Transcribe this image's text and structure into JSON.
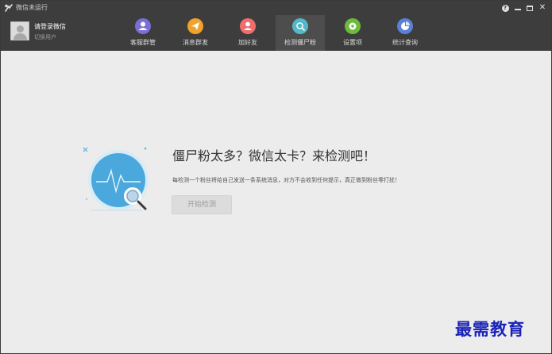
{
  "window": {
    "title": "微信未运行",
    "controls": {
      "help_icon": "help-icon",
      "minimize_icon": "minimize-icon",
      "maximize_icon": "maximize-icon",
      "close_icon": "close-icon",
      "help_glyph": "?",
      "close_glyph": "✕"
    }
  },
  "user": {
    "name": "请登录微信",
    "switch_label": "切换用户"
  },
  "nav": {
    "items": [
      {
        "label": "客服群管",
        "icon": "customer-service-icon",
        "color": "#7b6fd6"
      },
      {
        "label": "消息群发",
        "icon": "send-message-icon",
        "color": "#f0a22c"
      },
      {
        "label": "加好友",
        "icon": "add-friend-icon",
        "color": "#ee6e6e"
      },
      {
        "label": "检测僵尸粉",
        "icon": "detect-zombie-icon",
        "color": "#55b8c8",
        "active": true
      },
      {
        "label": "设置项",
        "icon": "settings-icon",
        "color": "#6dbb3c"
      },
      {
        "label": "统计查询",
        "icon": "statistics-icon",
        "color": "#5a80d8"
      }
    ]
  },
  "main": {
    "headline": "僵尸粉太多？微信太卡？来检测吧！",
    "description": "每检测一个粉丝将给自己发送一条系统消息，对方不会收到任何提示，真正做到粉丝零打扰！",
    "start_button": "开始检测",
    "illustration_icon": "magnifier-monitor-icon"
  },
  "watermark": "最需教育"
}
